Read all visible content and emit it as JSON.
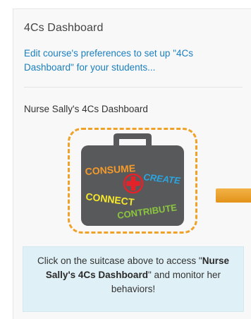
{
  "block": {
    "title": "4Cs Dashboard",
    "prefs_link": "Edit course's preferences to set up \"4Cs Dashboard\" for your students..."
  },
  "dashboard": {
    "title": "Nurse Sally's 4Cs Dashboard",
    "suitcase_icon": "suitcase-4cs-icon",
    "words": {
      "consume": "CONSUME",
      "create": "CREATE",
      "connect": "CONNECT",
      "contribute": "CONTRIBUTE"
    }
  },
  "info": {
    "prefix": "Click on the suitcase above to access \"",
    "name": "Nurse Sally's 4Cs Dashboard",
    "suffix": "\" and monitor her behaviors!"
  },
  "colors": {
    "link": "#1a7fbf",
    "frame": "#f0a127",
    "suitcase": "#58595b",
    "consume": "#f39a2b",
    "create": "#2ba6e0",
    "connect": "#f7e82a",
    "contribute": "#8cc63f",
    "cross": "#e32229",
    "info_bg": "#dff0f6"
  }
}
